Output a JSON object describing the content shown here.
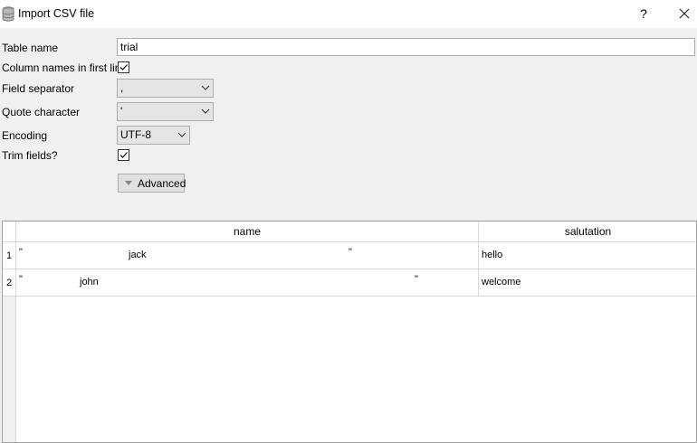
{
  "window": {
    "title": "Import CSV file",
    "help_label": "?"
  },
  "form": {
    "table_name": {
      "label": "Table name",
      "value": "trial"
    },
    "column_names_first_line": {
      "label": "Column names in first line",
      "checked": true
    },
    "field_separator": {
      "label": "Field separator",
      "value": ","
    },
    "quote_character": {
      "label": "Quote character",
      "value": "'"
    },
    "encoding": {
      "label": "Encoding",
      "value": "UTF-8"
    },
    "trim_fields": {
      "label": "Trim fields?",
      "checked": true
    },
    "advanced_label": "Advanced"
  },
  "preview": {
    "columns": [
      "name",
      "salutation"
    ],
    "rows": [
      {
        "num": "1",
        "name_open_quote": "\"",
        "name_text": "jack",
        "name_close_quote": "\"",
        "salutation": "hello"
      },
      {
        "num": "2",
        "name_open_quote": "\"",
        "name_text": "john",
        "name_close_quote": "\"",
        "salutation": "welcome"
      }
    ]
  }
}
